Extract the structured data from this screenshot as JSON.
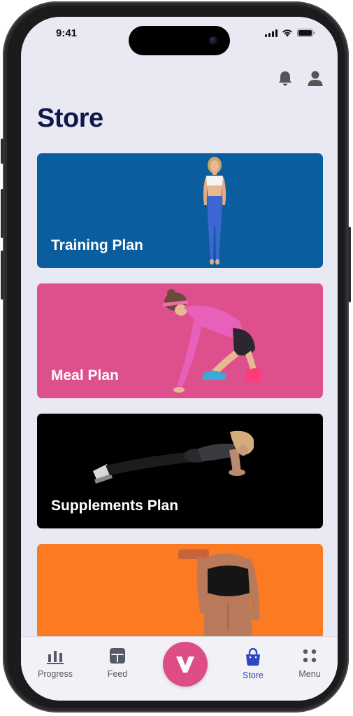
{
  "status_bar": {
    "time": "9:41"
  },
  "header": {
    "title": "Store"
  },
  "cards": [
    {
      "label": "Training Plan",
      "color": "#0b5e9e"
    },
    {
      "label": "Meal Plan",
      "color": "#de4f8e"
    },
    {
      "label": "Supplements Plan",
      "color": "#000000"
    },
    {
      "label": "",
      "color": "#fb7a22"
    }
  ],
  "tabbar": {
    "items": [
      {
        "label": "Progress",
        "icon": "bar-chart-icon",
        "active": false
      },
      {
        "label": "Feed",
        "icon": "feed-icon",
        "active": false
      },
      {
        "label": "",
        "icon": "v-logo-icon",
        "active": false
      },
      {
        "label": "Store",
        "icon": "shopping-bag-icon",
        "active": true
      },
      {
        "label": "Menu",
        "icon": "grid-dots-icon",
        "active": false
      }
    ],
    "active_color": "#2e46c4",
    "fab_color": "#df4d88"
  },
  "icons": [
    "bell-icon",
    "user-icon",
    "signal-icon",
    "wifi-icon",
    "battery-icon"
  ]
}
